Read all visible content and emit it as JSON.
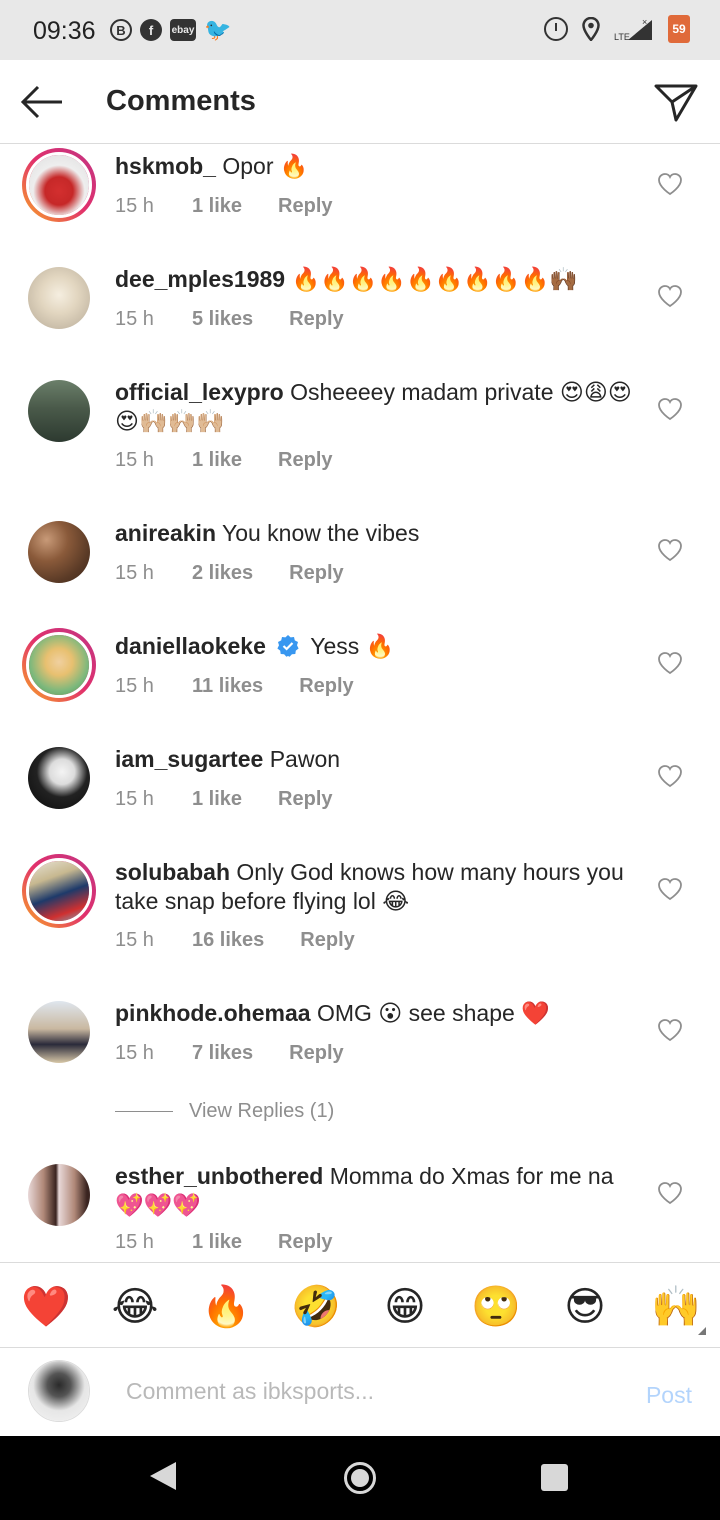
{
  "status_bar": {
    "time": "09:36",
    "left_icons": [
      "b-circle-icon",
      "facebook-icon",
      "ebay-icon",
      "twitter-icon"
    ],
    "ebay_label": "ebay",
    "network_label": "LTE",
    "battery_level": "59"
  },
  "header": {
    "title": "Comments"
  },
  "comments": [
    {
      "username": "hskmob_",
      "text": "Opor 🔥",
      "time": "15 h",
      "likes": "1 like",
      "reply": "Reply",
      "story_ring": true,
      "avatar_color": "#c62828"
    },
    {
      "username": "dee_mples1989",
      "text": "🔥🔥🔥🔥🔥🔥🔥🔥🔥🙌🏾",
      "time": "15 h",
      "likes": "5 likes",
      "reply": "Reply",
      "story_ring": false,
      "avatar_color": "#d8cfc0"
    },
    {
      "username": "official_lexypro",
      "text": "Osheeeey madam private 😍😩😍😍🙌🏼🙌🏼🙌🏼",
      "time": "15 h",
      "likes": "1 like",
      "reply": "Reply",
      "story_ring": false,
      "avatar_color": "#4a5a4a"
    },
    {
      "username": "anireakin",
      "text": "You know the vibes",
      "time": "15 h",
      "likes": "2 likes",
      "reply": "Reply",
      "story_ring": false,
      "avatar_color": "#8a5a3a"
    },
    {
      "username": "daniellaokeke",
      "verified": true,
      "text": "Yess 🔥",
      "time": "15 h",
      "likes": "11 likes",
      "reply": "Reply",
      "story_ring": true,
      "avatar_color": "#7cb87c"
    },
    {
      "username": "iam_sugartee",
      "text": "Pawon",
      "time": "15 h",
      "likes": "1 like",
      "reply": "Reply",
      "story_ring": false,
      "avatar_color": "#111111"
    },
    {
      "username": "solubabah",
      "text": "Only God knows how many hours you take snap before flying lol 😂",
      "time": "15 h",
      "likes": "16 likes",
      "reply": "Reply",
      "story_ring": true,
      "avatar_color": "#6fb2c9"
    },
    {
      "username": "pinkhode.ohemaa",
      "text": "OMG 😮 see shape ❤️",
      "time": "15 h",
      "likes": "7 likes",
      "reply": "Reply",
      "story_ring": false,
      "avatar_color": "#c9b8a0"
    },
    {
      "username": "esther_unbothered",
      "text": "Momma do Xmas for me na 💖💖💖",
      "time": "15 h",
      "likes": "1 like",
      "reply": "Reply",
      "story_ring": false,
      "avatar_color": "#b08878"
    }
  ],
  "view_replies": "View Replies (1)",
  "emoji_bar": [
    "❤️",
    "😂",
    "🔥",
    "🤣",
    "😁",
    "🙄",
    "😎",
    "🙌"
  ],
  "input": {
    "placeholder": "Comment as ibksports...",
    "post_label": "Post"
  }
}
